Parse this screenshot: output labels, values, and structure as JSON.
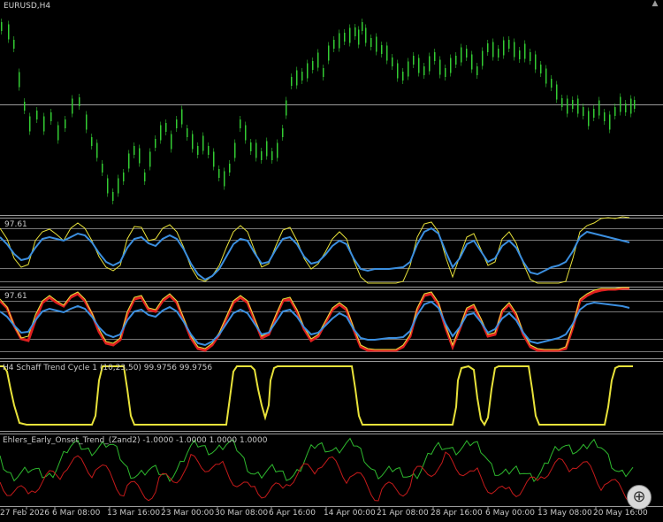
{
  "main": {
    "symbol_label": "EURUSD,H4",
    "candle_color": "#33cc33",
    "grid_color": "#7a7a7a"
  },
  "panels": [
    {
      "level_label": "97.61",
      "title": ""
    },
    {
      "level_label": "97.61",
      "title": ""
    },
    {
      "level_label": "",
      "title": "H4 Schaff Trend Cycle 1 (10,23,50) 99.9756 99.9756"
    },
    {
      "level_label": "",
      "title": "Ehlers_Early_Onset_Trend_(Zand2) -1.0000 -1.0000 1.0000 1.0000"
    }
  ],
  "line_colors": {
    "yellow": "#e8e23a",
    "blue": "#3b8fe0",
    "red": "#e02020",
    "green": "#2eb82e",
    "dark_red": "#c41a1a"
  },
  "time_axis": {
    "labels": [
      "27 Feb 2026",
      "6 Mar 08:00",
      "13 Mar 16:00",
      "23 Mar 00:00",
      "30 Mar 08:00",
      "6 Apr 16:00",
      "14 Apr 00:00",
      "21 Apr 08:00",
      "28 Apr 16:00",
      "6 May 00:00",
      "13 May 08:00",
      "20 May 16:00"
    ]
  },
  "icons": {
    "zoom": "zoom-in-icon",
    "scroll": "scroll-up-arrow-icon"
  }
}
